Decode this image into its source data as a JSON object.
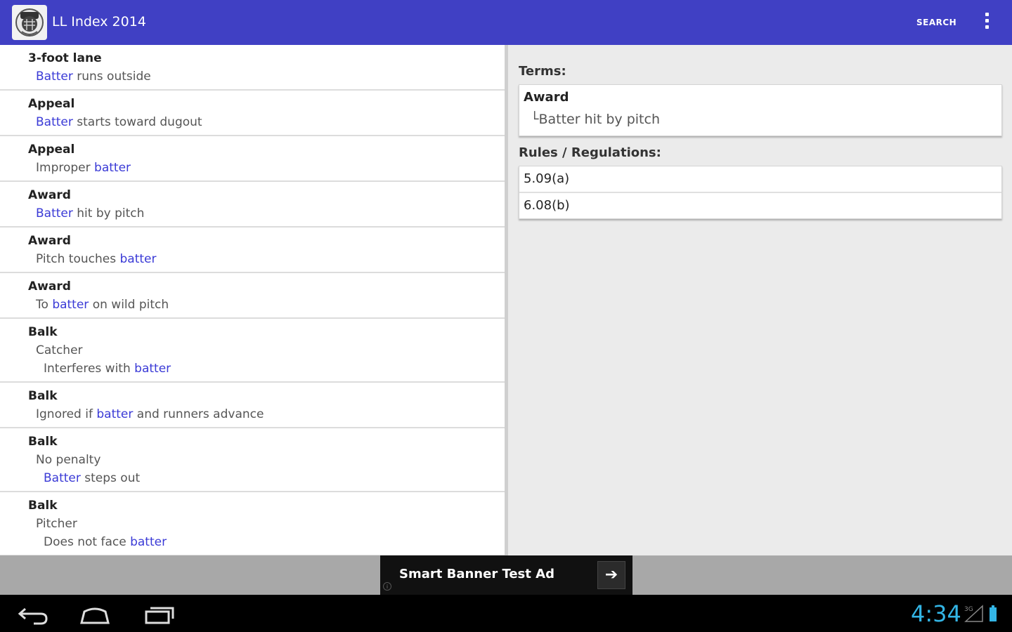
{
  "app": {
    "title": "LL Index 2014",
    "icon": "umpire-app-icon"
  },
  "actionbar": {
    "search_label": "SEARCH",
    "overflow_icon": "overflow-menu-icon"
  },
  "list": [
    {
      "title": "3-foot lane",
      "lines": [
        {
          "indent": 1,
          "parts": [
            {
              "text": "Batter",
              "hl": true
            },
            {
              "text": " runs outside",
              "hl": false
            }
          ]
        }
      ]
    },
    {
      "title": "Appeal",
      "lines": [
        {
          "indent": 1,
          "parts": [
            {
              "text": "Batter",
              "hl": true
            },
            {
              "text": " starts toward dugout",
              "hl": false
            }
          ]
        }
      ]
    },
    {
      "title": "Appeal",
      "lines": [
        {
          "indent": 1,
          "parts": [
            {
              "text": "Improper ",
              "hl": false
            },
            {
              "text": "batter",
              "hl": true
            }
          ]
        }
      ]
    },
    {
      "title": "Award",
      "lines": [
        {
          "indent": 1,
          "parts": [
            {
              "text": "Batter",
              "hl": true
            },
            {
              "text": " hit by pitch",
              "hl": false
            }
          ]
        }
      ]
    },
    {
      "title": "Award",
      "lines": [
        {
          "indent": 1,
          "parts": [
            {
              "text": "Pitch touches ",
              "hl": false
            },
            {
              "text": "batter",
              "hl": true
            }
          ]
        }
      ]
    },
    {
      "title": "Award",
      "lines": [
        {
          "indent": 1,
          "parts": [
            {
              "text": "To ",
              "hl": false
            },
            {
              "text": "batter",
              "hl": true
            },
            {
              "text": " on wild pitch",
              "hl": false
            }
          ]
        }
      ]
    },
    {
      "title": "Balk",
      "lines": [
        {
          "indent": 1,
          "parts": [
            {
              "text": "Catcher",
              "hl": false
            }
          ]
        },
        {
          "indent": 2,
          "parts": [
            {
              "text": "Interferes with ",
              "hl": false
            },
            {
              "text": "batter",
              "hl": true
            }
          ]
        }
      ]
    },
    {
      "title": "Balk",
      "lines": [
        {
          "indent": 1,
          "parts": [
            {
              "text": "Ignored if ",
              "hl": false
            },
            {
              "text": "batter",
              "hl": true
            },
            {
              "text": " and runners advance",
              "hl": false
            }
          ]
        }
      ]
    },
    {
      "title": "Balk",
      "lines": [
        {
          "indent": 1,
          "parts": [
            {
              "text": "No penalty",
              "hl": false
            }
          ]
        },
        {
          "indent": 2,
          "parts": [
            {
              "text": "Batter",
              "hl": true
            },
            {
              "text": " steps out",
              "hl": false
            }
          ]
        }
      ]
    },
    {
      "title": "Balk",
      "lines": [
        {
          "indent": 1,
          "parts": [
            {
              "text": "Pitcher",
              "hl": false
            }
          ]
        },
        {
          "indent": 2,
          "parts": [
            {
              "text": "Does not face ",
              "hl": false
            },
            {
              "text": "batter",
              "hl": true
            }
          ]
        }
      ]
    }
  ],
  "detail": {
    "terms_label": "Terms:",
    "term": {
      "title": "Award",
      "sub": "└Batter hit by pitch"
    },
    "rules_label": "Rules / Regulations:",
    "rules": [
      "5.09(a)",
      "6.08(b)"
    ]
  },
  "ad": {
    "text": "Smart Banner Test Ad",
    "arrow": "➔",
    "info": "i"
  },
  "system": {
    "time": "4:34",
    "accent": "#33b5e5",
    "signal": "3G"
  },
  "colors": {
    "actionbar": "#4040c4",
    "highlight": "#3a3ad6"
  }
}
